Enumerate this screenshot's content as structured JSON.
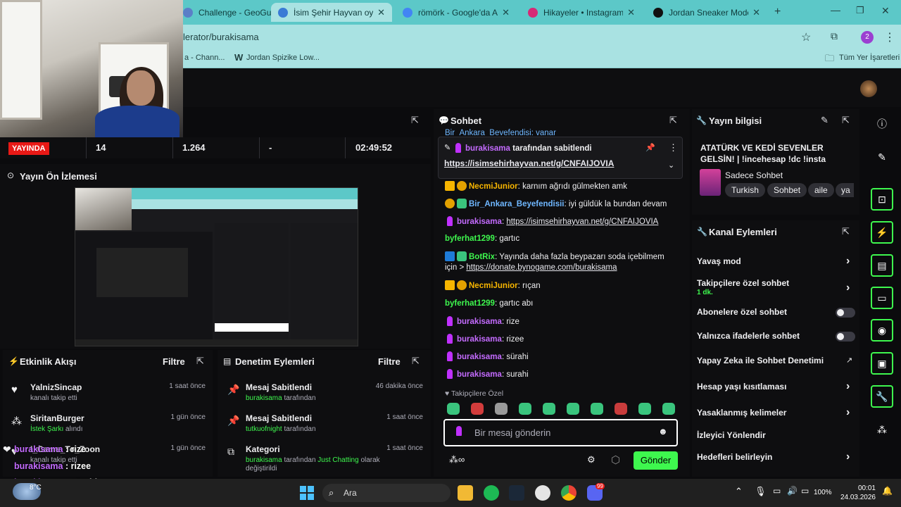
{
  "browser": {
    "tabs": [
      {
        "label": "Challenge - GeoGuess",
        "color": "#5b7fc7"
      },
      {
        "label": "İsim Şehir Hayvan oyunu",
        "color": "#3a7bd5"
      },
      {
        "label": "römörk - Google'da Ara",
        "color": "#4285f4"
      },
      {
        "label": "Hikayeler • Instagram",
        "color": "#d62976"
      },
      {
        "label": "Jordan Sneaker Modelleri",
        "color": "#111111"
      }
    ],
    "tab_close": "✕",
    "new_tab": "+",
    "url": "lerator/burakisama",
    "bookmarks": [
      "a - Chann...",
      "Jordan Spizike Low..."
    ],
    "all_bookmarks": "Tüm Yer İşaretleri",
    "profile_initial": "2"
  },
  "stats": {
    "live_label": "YAYINDA",
    "viewers": "14",
    "followers": "1.264",
    "dash": "-",
    "uptime": "02:49:52"
  },
  "preview": {
    "title": "Yayın Ön İzlemesi"
  },
  "activity": {
    "title": "Etkinlik Akışı",
    "filter": "Filtre",
    "items": [
      {
        "name": "YalnizSincap",
        "sub": "kanalı takip etti",
        "time": "1 saat önce",
        "icon": "heart-icon"
      },
      {
        "name": "SiritanBurger",
        "sub_hl": "İstek Şarkı",
        "sub": "alındı",
        "time": "1 gün önce",
        "icon": "channel-points-icon"
      },
      {
        "name": "I_Came_To_Zoon",
        "sub": "kanalı takip etti",
        "time": "1 gün önce",
        "icon": "heart-icon"
      }
    ]
  },
  "moderation": {
    "title": "Denetim Eylemleri",
    "filter": "Filtre",
    "items": [
      {
        "title": "Mesaj Sabitlendi",
        "user": "burakisama",
        "suffix": "tarafından",
        "time": "46 dakika önce"
      },
      {
        "title": "Mesaj Sabitlendi",
        "user": "tutkuofnight",
        "suffix": "tarafından",
        "time": "1 saat önce"
      },
      {
        "title": "Kategori",
        "user": "burakisama",
        "mid": "tarafından",
        "hl": "Just Chatting",
        "suffix": "olarak değiştirildi",
        "time": "1 saat önce"
      }
    ]
  },
  "chat": {
    "title": "Sohbet",
    "cut_top": "Bir_Ankara_Beyefendisi: vanar",
    "pinned": {
      "user": "burakisama",
      "text": "tarafından sabitlendi",
      "link": "https://isimsehirhayvan.net/g/CNFAIJOVIA"
    },
    "messages": [
      {
        "user": "NecmiJunior",
        "color": "#f7b500",
        "text": "karnım ağrıdı gülmekten amk",
        "badges": [
          "crown",
          "gold"
        ]
      },
      {
        "user": "Bir_Ankara_Beyefendisii",
        "color": "#6fb7ff",
        "text": "iyi güldük la bundan devam",
        "badges": [
          "gold",
          "green"
        ]
      },
      {
        "user": "burakisama",
        "color": "#c46bff",
        "text": "https://isimsehirhayvan.net/g/CNFAIJOVIA",
        "link": true,
        "badges": [
          "mic"
        ]
      },
      {
        "user": "byferhat1299",
        "color": "#3ef74e",
        "text": "gartıc",
        "badges": []
      },
      {
        "user": "BotRix",
        "color": "#3ef74e",
        "text": "Yayında daha fazla beypazarı soda içebilmem için >",
        "link_text": "https://donate.bynogame.com/burakisama",
        "badges": [
          "bot",
          "green"
        ]
      },
      {
        "user": "NecmiJunior",
        "color": "#f7b500",
        "text": "rıçan",
        "badges": [
          "crown",
          "gold"
        ]
      },
      {
        "user": "byferhat1299",
        "color": "#3ef74e",
        "text": "gartıc abı",
        "badges": []
      },
      {
        "user": "burakisama",
        "color": "#c46bff",
        "text": "rize",
        "badges": [
          "mic"
        ]
      },
      {
        "user": "burakisama",
        "color": "#c46bff",
        "text": "rizee",
        "badges": [
          "mic"
        ]
      },
      {
        "user": "burakisama",
        "color": "#c46bff",
        "text": "sürahi",
        "badges": [
          "mic"
        ]
      },
      {
        "user": "burakisama",
        "color": "#c46bff",
        "text": "surahi",
        "badges": [
          "mic"
        ]
      }
    ],
    "followers_only": "Takipçilere Özel",
    "placeholder": "Bir mesaj gönderin",
    "send": "Gönder"
  },
  "stream_info": {
    "title": "Yayın bilgisi",
    "stream_title": "ATATÜRK VE KEDİ SEVENLER GELSİN! | !incehesap !dc !insta",
    "category": "Sadece Sohbet",
    "tags": [
      "Turkish",
      "Sohbet",
      "aile",
      "ya"
    ]
  },
  "channel_actions": {
    "title": "Kanal Eylemleri",
    "items": [
      {
        "label": "Yavaş mod",
        "control": "chevron"
      },
      {
        "label": "Takipçilere özel sohbet",
        "sub": "1 dk.",
        "control": "chevron"
      },
      {
        "label": "Abonelere özel sohbet",
        "control": "toggle"
      },
      {
        "label": "Yalnızca ifadelerle sohbet",
        "control": "toggle"
      },
      {
        "label": "Yapay Zeka ile Sohbet Denetimi",
        "control": "external"
      },
      {
        "label": "Hesap yaşı kısıtlaması",
        "control": "chevron"
      },
      {
        "label": "Yasaklanmış kelimeler",
        "control": "chevron"
      },
      {
        "label": "İzleyici Yönlendir",
        "control": "none"
      },
      {
        "label": "Hedefleri belirleyin",
        "control": "chevron"
      }
    ]
  },
  "overlay_lines": [
    {
      "user": "burakisama",
      "text": ": rize"
    },
    {
      "user": "burakisama",
      "text": ": rizee"
    },
    {
      "user": "burakisama",
      "text": ": sürahi"
    },
    {
      "user": "burakisama",
      "text": ": surahı"
    }
  ],
  "taskbar": {
    "search": "Ara",
    "weather": "8°C",
    "battery": "100%",
    "time": "00:01",
    "date": "24.03.2026",
    "notif_count": "99"
  },
  "colors": {
    "accent_green": "#3ef74e",
    "live_red": "#e91916",
    "chrome_teal": "#5cc8c8"
  }
}
